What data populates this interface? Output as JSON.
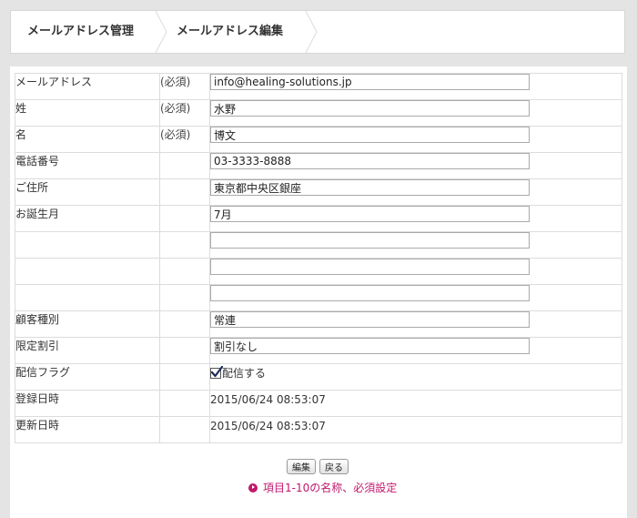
{
  "breadcrumb": {
    "items": [
      {
        "label": "メールアドレス管理"
      },
      {
        "label": "メールアドレス編集"
      }
    ]
  },
  "form": {
    "rows": [
      {
        "label": "メールアドレス",
        "required": "(必須)",
        "value": "info@healing-solutions.jp"
      },
      {
        "label": "姓",
        "required": "(必須)",
        "value": "水野"
      },
      {
        "label": "名",
        "required": "(必須)",
        "value": "博文"
      },
      {
        "label": "電話番号",
        "required": "",
        "value": "03-3333-8888"
      },
      {
        "label": "ご住所",
        "required": "",
        "value": "東京都中央区銀座"
      },
      {
        "label": "お誕生月",
        "required": "",
        "value": "7月"
      },
      {
        "label": "",
        "required": "",
        "value": ""
      },
      {
        "label": "",
        "required": "",
        "value": ""
      },
      {
        "label": "",
        "required": "",
        "value": ""
      },
      {
        "label": "顧客種別",
        "required": "",
        "value": "常連"
      },
      {
        "label": "限定割引",
        "required": "",
        "value": "割引なし"
      },
      {
        "label": "配信フラグ",
        "required": "",
        "value": "配信する",
        "checked": true
      },
      {
        "label": "登録日時",
        "required": "",
        "value": "2015/06/24 08:53:07"
      },
      {
        "label": "更新日時",
        "required": "",
        "value": "2015/06/24 08:53:07"
      }
    ]
  },
  "actions": {
    "edit_label": "編集",
    "back_label": "戻る"
  },
  "link": {
    "label": "項目1-10の名称、必須設定",
    "color": "#c0186c"
  }
}
